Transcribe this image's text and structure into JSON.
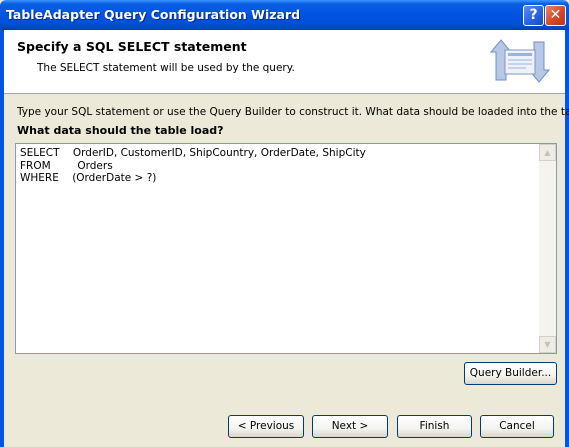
{
  "window": {
    "title": "TableAdapter Query Configuration Wizard"
  },
  "titlebar_buttons": {
    "help": "?",
    "close": "✕"
  },
  "header": {
    "title": "Specify a SQL SELECT statement",
    "subtitle": "The SELECT statement will be used by the query."
  },
  "body": {
    "instruction": "Type your SQL statement or use the Query Builder to construct it. What data should be loaded into the table?",
    "prompt_label": "What data should the table load?",
    "sql_statement": "SELECT    OrderID, CustomerID, ShipCountry, OrderDate, ShipCity\nFROM        Orders\nWHERE    (OrderDate > ?)"
  },
  "buttons": {
    "query_builder": "Query Builder...",
    "previous": "< Previous",
    "next": "Next >",
    "finish": "Finish",
    "cancel": "Cancel"
  },
  "icons": {
    "wizard": "database-wizard-icon",
    "help": "help-icon",
    "close": "close-icon",
    "scroll_up": "scroll-up-arrow-icon",
    "scroll_down": "scroll-down-arrow-icon"
  },
  "colors": {
    "titlebar": "#0054e3",
    "close_button": "#d5482a",
    "dialog_bg": "#ece9d8",
    "button_border": "#003c74"
  }
}
